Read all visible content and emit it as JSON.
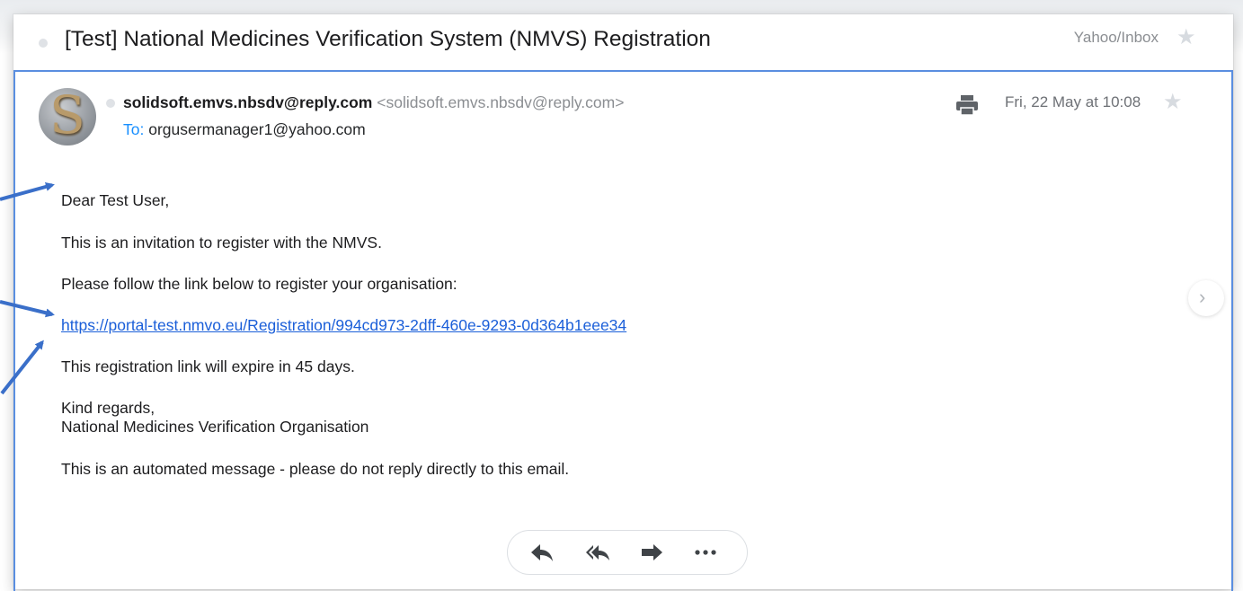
{
  "subject": "[Test] National Medicines Verification System (NMVS) Registration",
  "folder": "Yahoo/Inbox",
  "sender": {
    "name": "solidsoft.emvs.nbsdv@reply.com",
    "address": "<solidsoft.emvs.nbsdv@reply.com>",
    "avatar_letter": "S"
  },
  "recipient": {
    "label": "To:",
    "address": "orgusermanager1@yahoo.com"
  },
  "date": "Fri, 22 May at 10:08",
  "body": {
    "greeting": "Dear Test User,",
    "line1": "This is an invitation to register with the NMVS.",
    "line2": "Please follow the link below to register your organisation:",
    "link": "https://portal-test.nmvo.eu/Registration/994cd973-2dff-460e-9293-0d364b1eee34",
    "line3": "This registration link will expire in 45 days.",
    "signoff": "Kind regards,",
    "signature": "National Medicines Verification Organisation",
    "footer": "This is an automated message - please do not reply directly to this email."
  },
  "icons": {
    "star": "star-icon",
    "print": "print-icon",
    "reply": "reply-icon",
    "reply_all": "reply-all-icon",
    "forward": "forward-icon",
    "more": "more-icon",
    "next": "chevron-right-icon"
  },
  "colors": {
    "message_border": "#5a8ee0",
    "link": "#1b5fd9",
    "to_label": "#188fff",
    "annotation_arrow": "#3a6fc9"
  }
}
